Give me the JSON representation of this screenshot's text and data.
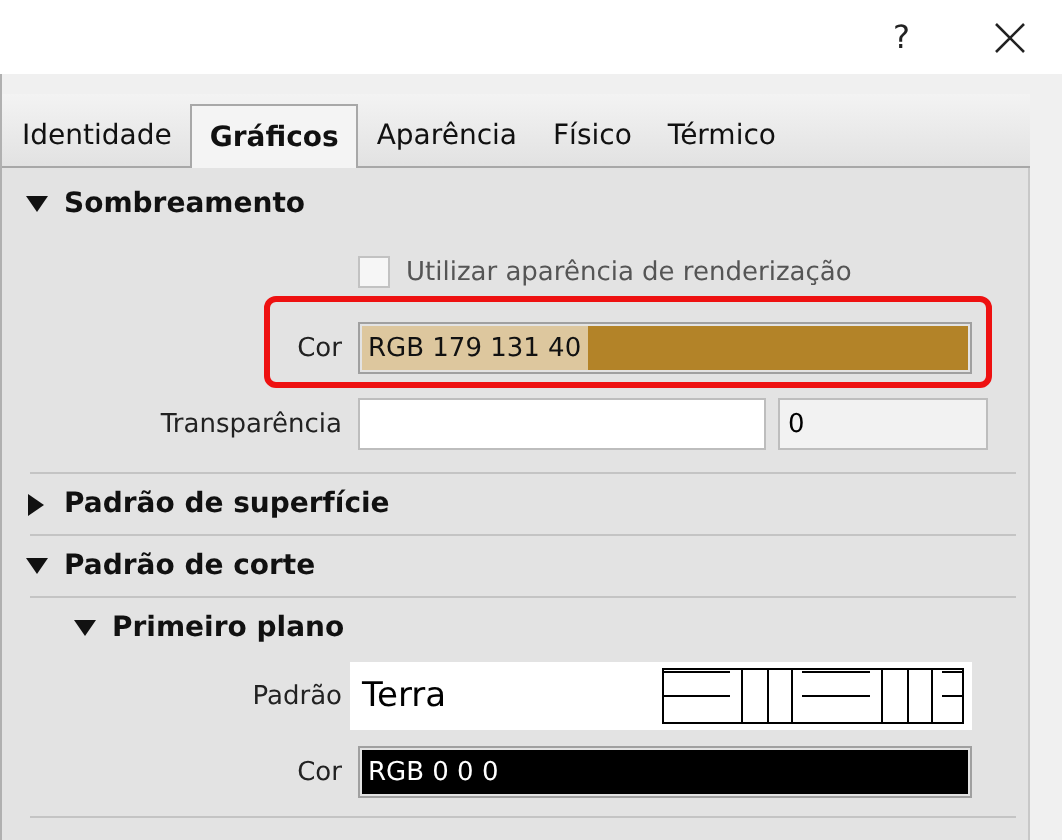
{
  "window": {
    "help_button": "?"
  },
  "tabs": [
    {
      "label": "Identidade",
      "selected": false
    },
    {
      "label": "Gráficos",
      "selected": true
    },
    {
      "label": "Aparência",
      "selected": false
    },
    {
      "label": "Físico",
      "selected": false
    },
    {
      "label": "Térmico",
      "selected": false
    }
  ],
  "sections": [
    {
      "title": "Sombreamento",
      "expanded": true,
      "rows": [
        {
          "kind": "checkbox",
          "label": "Utilizar aparência de renderização",
          "checked": false
        },
        {
          "kind": "color",
          "label": "Cor",
          "value": "RGB 179 131 40",
          "color": "#b38328",
          "highlighted": true
        },
        {
          "kind": "slider",
          "label": "Transparência",
          "value": "0"
        }
      ]
    },
    {
      "title": "Padrão de superfície",
      "expanded": false
    },
    {
      "title": "Padrão de corte",
      "expanded": true,
      "children": [
        {
          "title": "Primeiro plano",
          "expanded": true,
          "rows": [
            {
              "kind": "pattern",
              "label": "Padrão",
              "value": "Terra"
            },
            {
              "kind": "color",
              "label": "Cor",
              "value": "RGB 0 0 0",
              "color": "#000000",
              "highlighted": false
            }
          ]
        }
      ]
    }
  ]
}
